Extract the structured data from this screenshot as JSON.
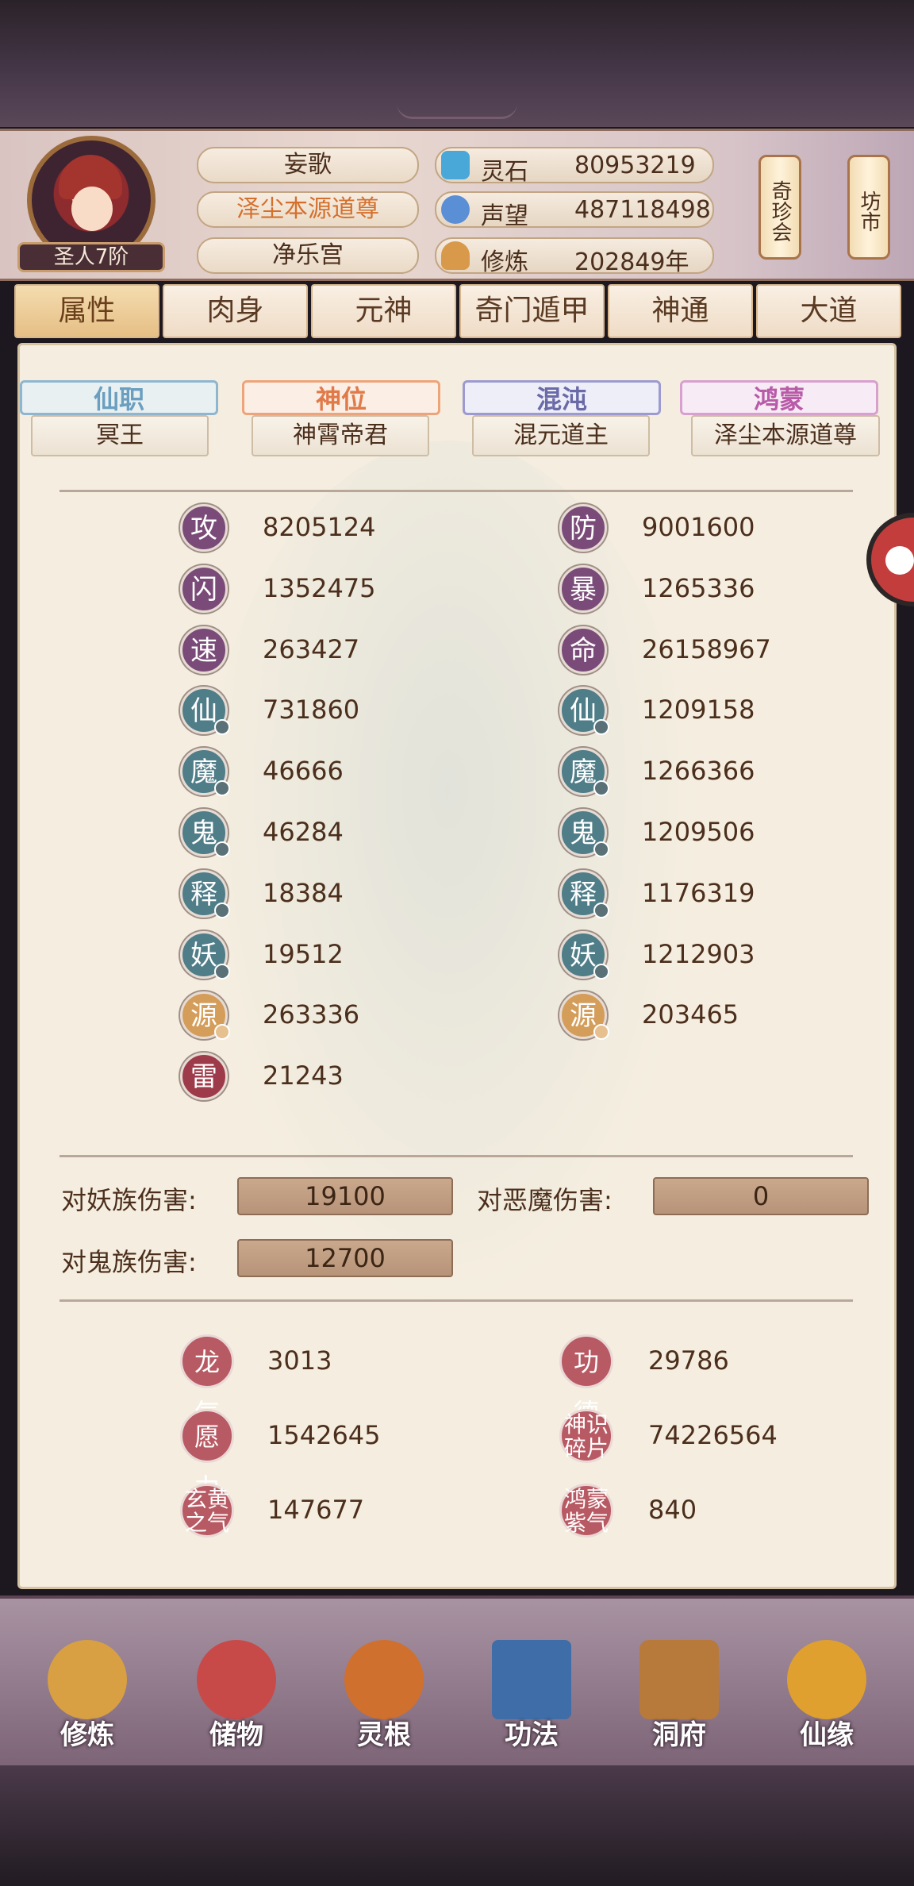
{
  "header": {
    "rank": "圣人7阶",
    "names": [
      "妄歌",
      "泽尘本源道尊",
      "净乐宫"
    ],
    "resources": [
      {
        "icon": "spirit-stone-icon",
        "label": "灵石",
        "value": "80953219",
        "color": "#4aa8d8"
      },
      {
        "icon": "reputation-icon",
        "label": "声望",
        "value": "487118498",
        "color": "#5a8fd6"
      },
      {
        "icon": "meditation-icon",
        "label": "修炼",
        "value": "202849年",
        "color": "#d89a4a"
      }
    ],
    "shops": [
      "奇珍会",
      "坊市"
    ]
  },
  "tabs": [
    "属性",
    "肉身",
    "元神",
    "奇门遁甲",
    "神通",
    "大道"
  ],
  "titles": [
    {
      "label": "仙职",
      "value": "冥王",
      "color": "#6a9fbf"
    },
    {
      "label": "神位",
      "value": "神霄帝君",
      "color": "#e07a48"
    },
    {
      "label": "混沌",
      "value": "混元道主",
      "color": "#6b6aa8"
    },
    {
      "label": "鸿蒙",
      "value": "泽尘本源道尊",
      "color": "#b85aa8"
    }
  ],
  "stats_left": [
    {
      "icon": "攻",
      "value": "8205124",
      "kind": "purple"
    },
    {
      "icon": "闪",
      "value": "1352475",
      "kind": "purple"
    },
    {
      "icon": "速",
      "value": "263427",
      "kind": "purple"
    },
    {
      "icon": "仙",
      "value": "731860",
      "kind": "teal"
    },
    {
      "icon": "魔",
      "value": "46666",
      "kind": "teal"
    },
    {
      "icon": "鬼",
      "value": "46284",
      "kind": "teal"
    },
    {
      "icon": "释",
      "value": "18384",
      "kind": "teal"
    },
    {
      "icon": "妖",
      "value": "19512",
      "kind": "teal"
    },
    {
      "icon": "源",
      "value": "263336",
      "kind": "gold"
    },
    {
      "icon": "雷",
      "value": "21243",
      "kind": "red"
    }
  ],
  "stats_right": [
    {
      "icon": "防",
      "value": "9001600",
      "kind": "purple"
    },
    {
      "icon": "暴",
      "value": "1265336",
      "kind": "purple"
    },
    {
      "icon": "命",
      "value": "26158967",
      "kind": "purple"
    },
    {
      "icon": "仙",
      "value": "1209158",
      "kind": "teal"
    },
    {
      "icon": "魔",
      "value": "1266366",
      "kind": "teal"
    },
    {
      "icon": "鬼",
      "value": "1209506",
      "kind": "teal"
    },
    {
      "icon": "释",
      "value": "1176319",
      "kind": "teal"
    },
    {
      "icon": "妖",
      "value": "1212903",
      "kind": "teal"
    },
    {
      "icon": "源",
      "value": "203465",
      "kind": "gold"
    }
  ],
  "damage": [
    {
      "label": "对妖族伤害:",
      "value": "19100"
    },
    {
      "label": "对恶魔伤害:",
      "value": "0"
    },
    {
      "label": "对鬼族伤害:",
      "value": "12700"
    }
  ],
  "misc": [
    {
      "icon": "龙气",
      "value": "3013"
    },
    {
      "icon": "功德",
      "value": "29786"
    },
    {
      "icon": "愿力",
      "value": "1542645"
    },
    {
      "icon": "神识碎片",
      "value": "74226564"
    },
    {
      "icon": "玄黄之气",
      "value": "147677"
    },
    {
      "icon": "鸿蒙紫气",
      "value": "840"
    }
  ],
  "nav": [
    "修炼",
    "储物",
    "灵根",
    "功法",
    "洞府",
    "仙缘"
  ]
}
